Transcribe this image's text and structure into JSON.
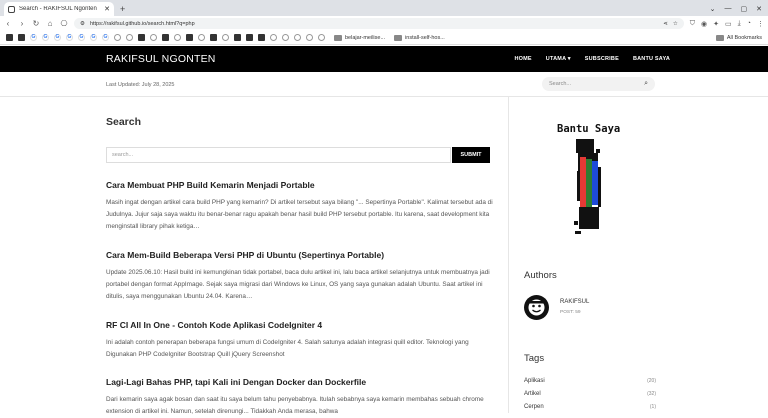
{
  "browser": {
    "tab_title": "Search - RAKIFSUL Ngonten",
    "new_tab": "+",
    "url": "https://rakifsul.github.io/search.html?q=php",
    "bookmarks": [
      {
        "icon": "google-icon",
        "glyph": "G"
      },
      {
        "icon": "google-icon",
        "glyph": "G"
      },
      {
        "icon": "google-icon",
        "glyph": "G"
      },
      {
        "icon": "google-icon",
        "glyph": "G"
      },
      {
        "icon": "google-icon",
        "glyph": "G"
      },
      {
        "icon": "google-icon",
        "glyph": "G"
      },
      {
        "icon": "google-icon",
        "glyph": "G"
      }
    ],
    "bookmark_folder_1": "belajar-meilise...",
    "bookmark_folder_2": "install-self-hos...",
    "all_bookmarks": "All Bookmarks"
  },
  "site": {
    "logo": "RAKIFSUL NGONTEN",
    "menu": [
      "HOME",
      "UTAMA",
      "SUBSCRIBE",
      "BANTU SAYA"
    ],
    "last_updated": "Last Updated: July 28, 2025",
    "search_placeholder": "Search..."
  },
  "main": {
    "title": "Search",
    "search_placeholder": "search...",
    "submit_label": "SUBMIT",
    "posts": [
      {
        "title": "Cara Membuat PHP Build Kemarin Menjadi Portable",
        "excerpt": "Masih ingat dengan artikel cara build PHP yang kemarin? Di artikel tersebut saya bilang \"... Sepertinya Portable\". Kalimat tersebut ada di Judulnya. Jujur saja saya waktu itu benar-benar ragu apakah benar hasil build PHP tersebut portable. Itu karena, saat development kita menginstall library pihak ketiga…"
      },
      {
        "title": "Cara Mem-Build Beberapa Versi PHP di Ubuntu (Sepertinya Portable)",
        "excerpt": "Update 2025.06.10: Hasil build ini kemungkinan tidak portabel, baca dulu artikel ini, lalu baca artikel selanjutnya untuk membuatnya jadi portabel dengan format AppImage. Sejak saya migrasi dari Windows ke Linux, OS yang saya gunakan adalah Ubuntu. Saat artikel ini ditulis, saya menggunakan Ubuntu 24.04. Karena…"
      },
      {
        "title": "RF CI All In One - Contoh Kode Aplikasi CodeIgniter 4",
        "excerpt": "Ini adalah contoh penerapan beberapa fungsi umum di CodeIgniter 4. Salah satunya adalah integrasi quill editor. Teknologi yang Digunakan PHP CodeIgniter Bootstrap Quill jQuery Screenshot"
      },
      {
        "title": "Lagi-Lagi Bahas PHP, tapi Kali ini Dengan Docker dan Dockerfile",
        "excerpt": "Dari kemarin saya agak bosan dan saat itu saya belum tahu penyebabnya. Itulah sebabnya saya kemarin membahas sebuah chrome extension di artikel ini. Namun, setelah direnungi... Tidakkah Anda merasa, bahwa"
      }
    ]
  },
  "sidebar": {
    "bantu_title": "Bantu Saya",
    "authors_heading": "Authors",
    "author_name": "RAKIFSUL",
    "author_posts": "POST: 59",
    "tags_heading": "Tags",
    "tags": [
      {
        "label": "Aplikasi",
        "count": "(20)"
      },
      {
        "label": "Artikel",
        "count": "(32)"
      },
      {
        "label": "Cerpen",
        "count": "(1)"
      }
    ]
  }
}
